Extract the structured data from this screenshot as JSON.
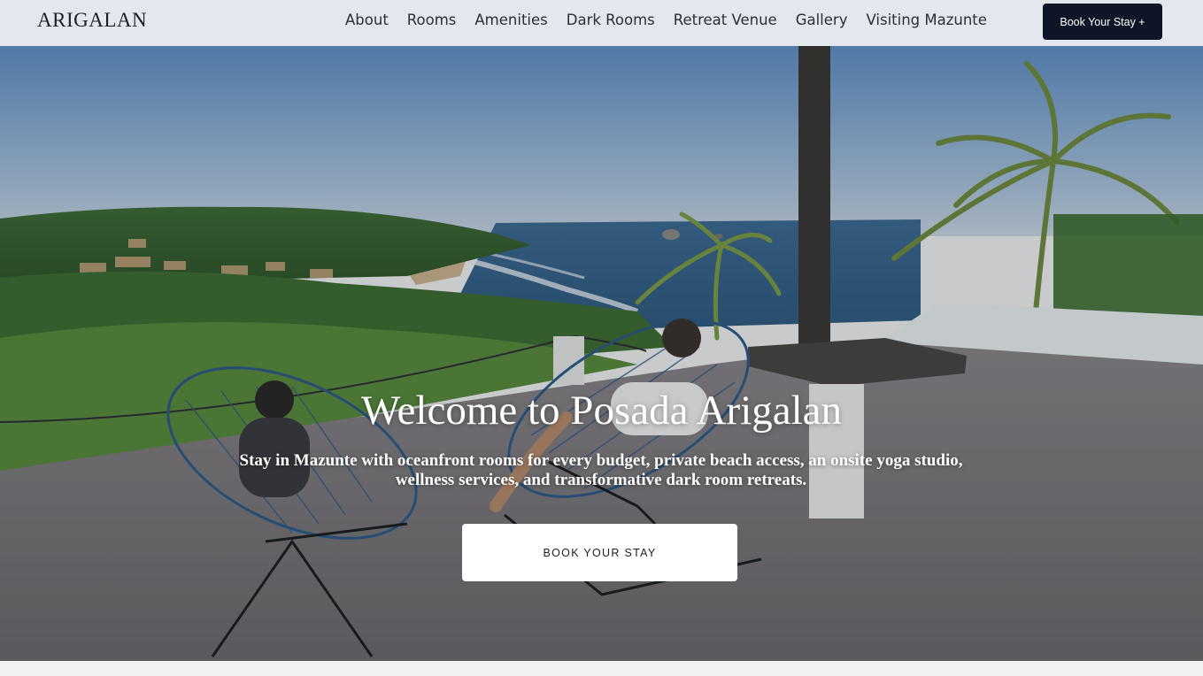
{
  "brand": {
    "logo_text": "ARIGALAN"
  },
  "nav": {
    "items": [
      {
        "label": "About"
      },
      {
        "label": "Rooms"
      },
      {
        "label": "Amenities"
      },
      {
        "label": "Dark Rooms"
      },
      {
        "label": "Retreat Venue"
      },
      {
        "label": "Gallery"
      },
      {
        "label": "Visiting Mazunte"
      }
    ],
    "book_button_label": "Book Your Stay +"
  },
  "hero": {
    "title": "Welcome to Posada Arigalan",
    "subtitle": "Stay in Mazunte with oceanfront rooms for every budget, private beach access, an onsite yoga studio, wellness services, and transformative dark room retreats.",
    "cta_label": "BOOK YOUR STAY",
    "image_icon": "hero-photo"
  },
  "colors": {
    "header_bg": "#e3e7ee",
    "button_dark": "#0e1526",
    "cta_bg": "#ffffff"
  }
}
